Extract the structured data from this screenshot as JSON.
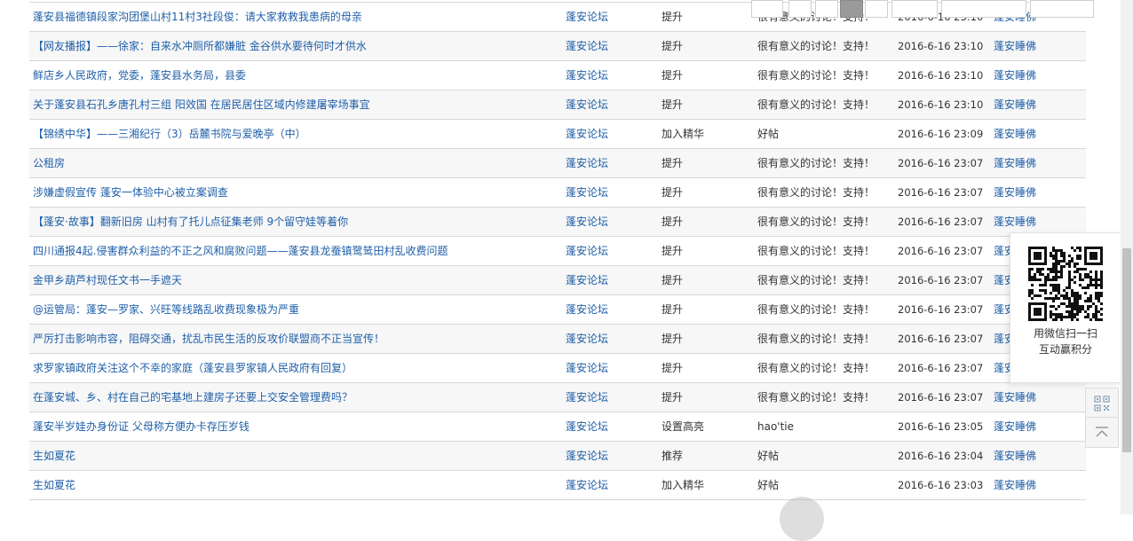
{
  "rows": [
    {
      "title": "蓬安县福德镇段家沟团堡山村11村3社段俊：请大家救救我患病的母亲",
      "forum": "蓬安论坛",
      "action": "提升",
      "comment": "很有意义的讨论！支持！",
      "time": "2016-6-16 23:10",
      "user": "蓬安睡佛"
    },
    {
      "title": "【网友播报】——徐家：自来水冲厕所都嫌脏 金谷供水要待何时才供水",
      "forum": "蓬安论坛",
      "action": "提升",
      "comment": "很有意义的讨论！支持！",
      "time": "2016-6-16 23:10",
      "user": "蓬安睡佛"
    },
    {
      "title": "鲜店乡人民政府，党委，蓬安县水务局，县委",
      "forum": "蓬安论坛",
      "action": "提升",
      "comment": "很有意义的讨论！支持！",
      "time": "2016-6-16 23:10",
      "user": "蓬安睡佛"
    },
    {
      "title": "关于蓬安县石孔乡唐孔村三组 阳效国 在居民居住区域内修建屠宰场事宜",
      "forum": "蓬安论坛",
      "action": "提升",
      "comment": "很有意义的讨论！支持！",
      "time": "2016-6-16 23:10",
      "user": "蓬安睡佛"
    },
    {
      "title": "【锦绣中华】——三湘纪行（3）岳麓书院与爱晚亭（中）",
      "forum": "蓬安论坛",
      "action": "加入精华",
      "comment": "好帖",
      "time": "2016-6-16 23:09",
      "user": "蓬安睡佛"
    },
    {
      "title": "公租房",
      "forum": "蓬安论坛",
      "action": "提升",
      "comment": "很有意义的讨论！支持！",
      "time": "2016-6-16 23:07",
      "user": "蓬安睡佛"
    },
    {
      "title": "涉嫌虚假宣传 蓬安一体验中心被立案调查",
      "forum": "蓬安论坛",
      "action": "提升",
      "comment": "很有意义的讨论！支持！",
      "time": "2016-6-16 23:07",
      "user": "蓬安睡佛"
    },
    {
      "title": "【蓬安·故事】翻新旧房 山村有了托儿点征集老师 9个留守娃等着你",
      "forum": "蓬安论坛",
      "action": "提升",
      "comment": "很有意义的讨论！支持！",
      "time": "2016-6-16 23:07",
      "user": "蓬安睡佛"
    },
    {
      "title": "四川通报4起.侵害群众利益的不正之风和腐败问题——蓬安县龙蚕镇鹭鸶田村乱收费问题",
      "forum": "蓬安论坛",
      "action": "提升",
      "comment": "很有意义的讨论！支持！",
      "time": "2016-6-16 23:07",
      "user": "蓬安睡佛"
    },
    {
      "title": "金甲乡葫芦村现任文书一手遮天",
      "forum": "蓬安论坛",
      "action": "提升",
      "comment": "很有意义的讨论！支持！",
      "time": "2016-6-16 23:07",
      "user": "蓬安睡佛"
    },
    {
      "title": "@运管局：蓬安—罗家、兴旺等线路乱收费现象极为严重",
      "forum": "蓬安论坛",
      "action": "提升",
      "comment": "很有意义的讨论！支持！",
      "time": "2016-6-16 23:07",
      "user": "蓬安睡佛"
    },
    {
      "title": "严厉打击影响市容，阻碍交通，扰乱市民生活的反攻价联盟商不正当宣传！",
      "forum": "蓬安论坛",
      "action": "提升",
      "comment": "很有意义的讨论！支持！",
      "time": "2016-6-16 23:07",
      "user": "蓬安睡佛"
    },
    {
      "title": "求罗家镇政府关注这个不幸的家庭（蓬安县罗家镇人民政府有回复）",
      "forum": "蓬安论坛",
      "action": "提升",
      "comment": "很有意义的讨论！支持！",
      "time": "2016-6-16 23:07",
      "user": "蓬安睡佛"
    },
    {
      "title": "在蓬安城、乡、村在自己的宅基地上建房子还要上交安全管理费吗？",
      "forum": "蓬安论坛",
      "action": "提升",
      "comment": "很有意义的讨论！支持！",
      "time": "2016-6-16 23:07",
      "user": "蓬安睡佛"
    },
    {
      "title": "蓬安半岁娃办身份证 父母称方便办卡存压岁钱",
      "forum": "蓬安论坛",
      "action": "设置高亮",
      "comment": "hao'tie",
      "time": "2016-6-16 23:05",
      "user": "蓬安睡佛"
    },
    {
      "title": "生如夏花",
      "forum": "蓬安论坛",
      "action": "推荐",
      "comment": "好帖",
      "time": "2016-6-16 23:04",
      "user": "蓬安睡佛"
    },
    {
      "title": "生如夏花",
      "forum": "蓬安论坛",
      "action": "加入精华",
      "comment": "好帖",
      "time": "2016-6-16 23:03",
      "user": "蓬安睡佛"
    }
  ],
  "qr_panel": {
    "caption_line1": "用微信扫一扫",
    "caption_line2": "互动赢积分"
  },
  "side_buttons": [
    "qr-code-icon",
    "back-to-top-icon"
  ],
  "colors": {
    "link": "#1f5fa8",
    "border": "#d7d7d7",
    "row_alt": "#f7f7f7"
  }
}
